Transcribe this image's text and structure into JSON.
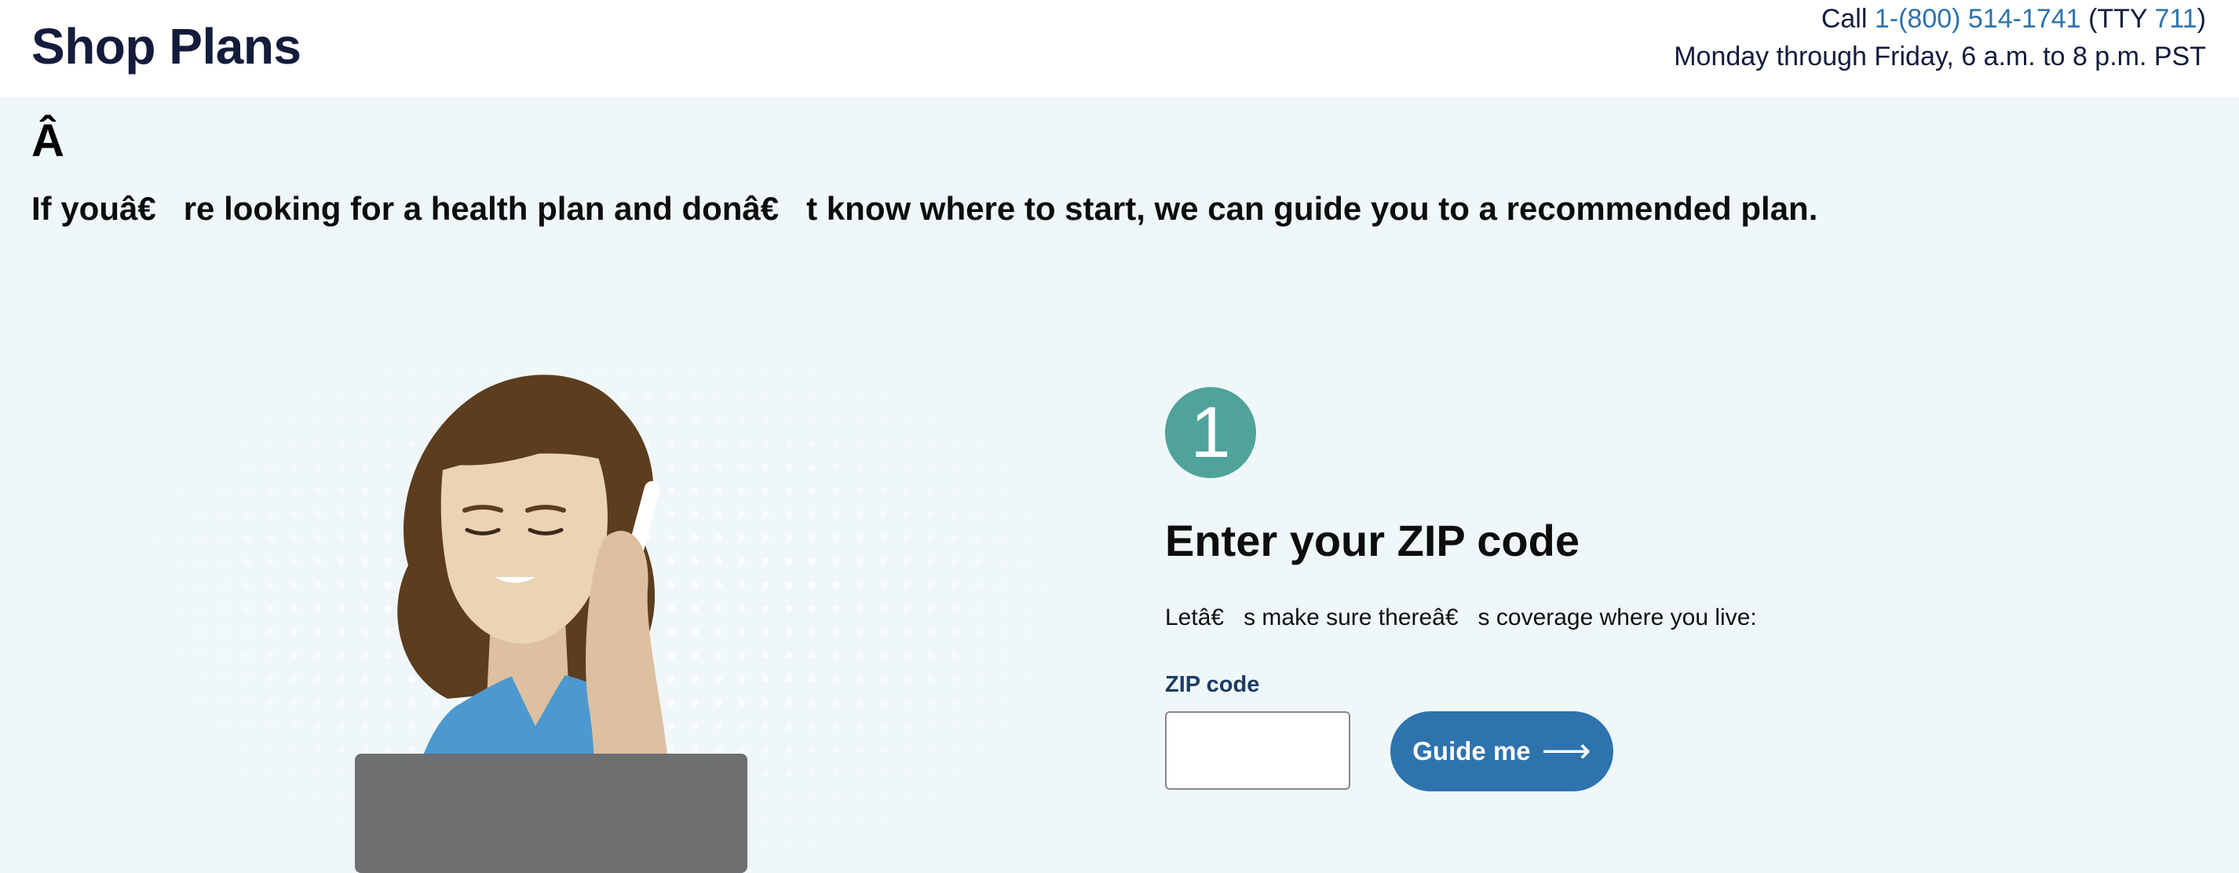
{
  "header": {
    "title": "Shop Plans",
    "call_prefix": "Call",
    "phone": "1-(800) 514-1741",
    "tty_open": "(TTY",
    "tty_number": "711",
    "tty_close": ")",
    "hours": "Monday through Friday, 6 a.m. to 8 p.m. PST"
  },
  "intro": {
    "stray_char": "Â",
    "text": "If youâ€   re looking for a health plan and donâ€   t know where to start, we can guide you to a recommended plan."
  },
  "step": {
    "number": "1",
    "title": "Enter your ZIP code",
    "description": "Letâ€   s make sure thereâ€   s coverage where you live:",
    "zip_label": "ZIP code",
    "zip_value": "",
    "zip_placeholder": "",
    "button_label": "Guide me",
    "button_icon": "arrow-right-icon"
  },
  "colors": {
    "brand_navy": "#141c3c",
    "link_blue": "#2e73ad",
    "badge_teal": "#4fa39b",
    "page_bg": "#eff7f9"
  }
}
